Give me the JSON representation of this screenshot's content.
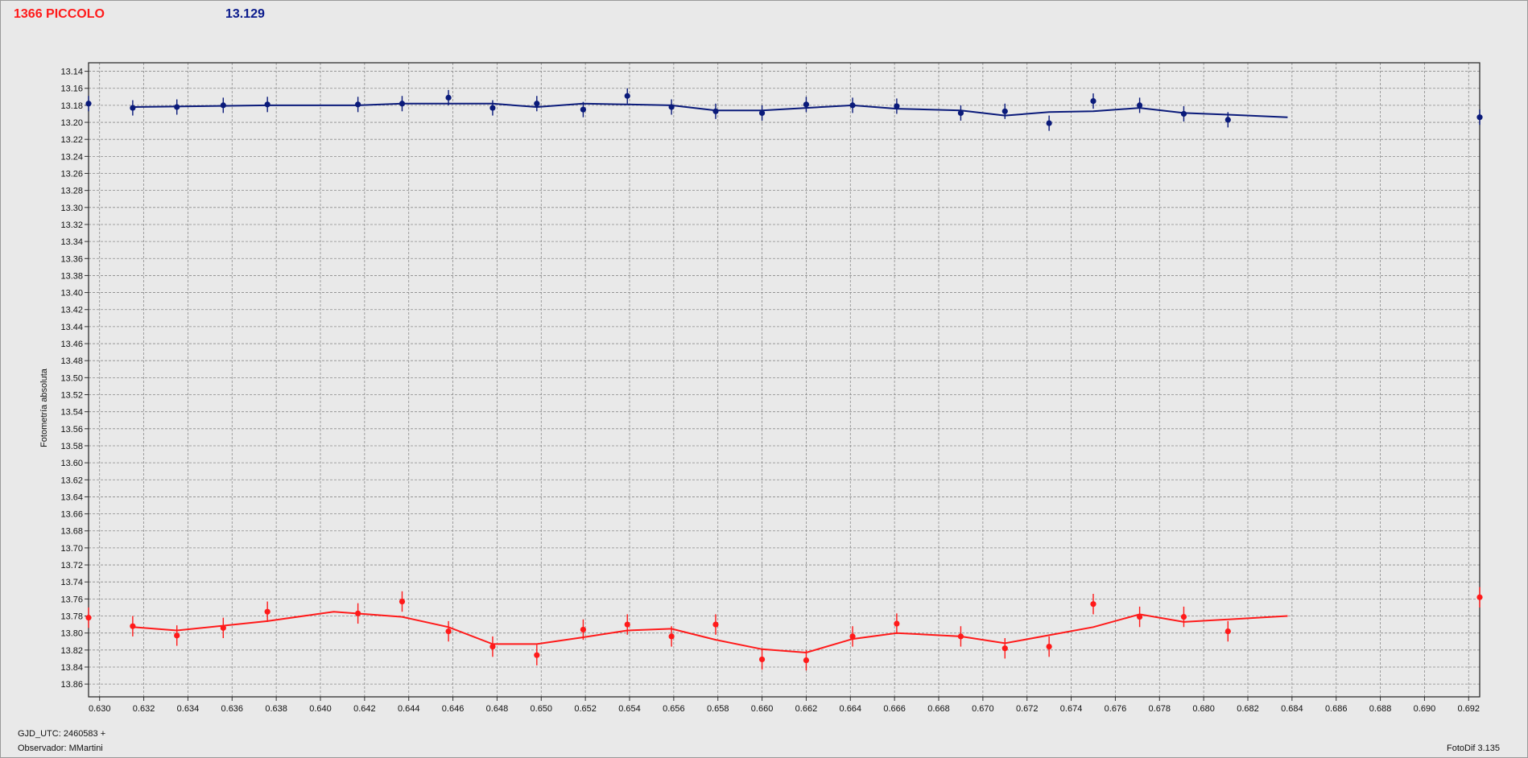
{
  "header": {
    "object_name": "1366 PICCOLO",
    "reference_mag": "13.129"
  },
  "footer": {
    "gjd_label": "GJD_UTC: 2460583 +",
    "observer_label": "Observador: MMartini",
    "software_label": "FotoDif 3.135"
  },
  "colors": {
    "series_blue": "#0a1a7a",
    "series_red": "#ff1a1a",
    "grid": "#8a8a8a",
    "plot_bg": "#e9e9e9"
  },
  "chart_data": {
    "type": "scatter",
    "title": "1366 PICCOLO",
    "xlabel": "GJD_UTC: 2460583 +",
    "ylabel": "Fotometría absoluta",
    "xlim": [
      0.6295,
      0.6925
    ],
    "ylim": [
      13.13,
      13.875
    ],
    "y_inverted": true,
    "grid": true,
    "x_ticks": [
      "0.630",
      "0.632",
      "0.634",
      "0.636",
      "0.638",
      "0.640",
      "0.642",
      "0.644",
      "0.646",
      "0.648",
      "0.650",
      "0.652",
      "0.654",
      "0.656",
      "0.658",
      "0.660",
      "0.662",
      "0.664",
      "0.666",
      "0.668",
      "0.670",
      "0.672",
      "0.674",
      "0.676",
      "0.678",
      "0.680",
      "0.682",
      "0.684",
      "0.686",
      "0.688",
      "0.690",
      "0.692"
    ],
    "y_ticks": [
      "13.14",
      "13.16",
      "13.18",
      "13.20",
      "13.22",
      "13.24",
      "13.26",
      "13.28",
      "13.30",
      "13.32",
      "13.34",
      "13.36",
      "13.38",
      "13.40",
      "13.42",
      "13.44",
      "13.46",
      "13.48",
      "13.50",
      "13.52",
      "13.54",
      "13.56",
      "13.58",
      "13.60",
      "13.62",
      "13.64",
      "13.66",
      "13.68",
      "13.70",
      "13.72",
      "13.74",
      "13.76",
      "13.78",
      "13.80",
      "13.82",
      "13.84",
      "13.86"
    ],
    "series": [
      {
        "color": "#0a1a7a",
        "points": [
          [
            0.6295,
            13.178
          ],
          [
            0.6315,
            13.183
          ],
          [
            0.6335,
            13.182
          ],
          [
            0.6356,
            13.18
          ],
          [
            0.6376,
            13.179
          ],
          [
            0.6417,
            13.179
          ],
          [
            0.6437,
            13.178
          ],
          [
            0.6458,
            13.171
          ],
          [
            0.6478,
            13.183
          ],
          [
            0.6498,
            13.178
          ],
          [
            0.6519,
            13.185
          ],
          [
            0.6539,
            13.169
          ],
          [
            0.6559,
            13.182
          ],
          [
            0.6579,
            13.187
          ],
          [
            0.66,
            13.189
          ],
          [
            0.662,
            13.179
          ],
          [
            0.6641,
            13.18
          ],
          [
            0.6661,
            13.181
          ],
          [
            0.669,
            13.189
          ],
          [
            0.671,
            13.187
          ],
          [
            0.673,
            13.201
          ],
          [
            0.675,
            13.175
          ],
          [
            0.6771,
            13.18
          ],
          [
            0.6791,
            13.19
          ],
          [
            0.6811,
            13.197
          ],
          [
            0.6925,
            13.194
          ]
        ],
        "error": 0.009,
        "trend": [
          [
            0.6315,
            13.182
          ],
          [
            0.6376,
            13.18
          ],
          [
            0.6417,
            13.18
          ],
          [
            0.6437,
            13.178
          ],
          [
            0.6478,
            13.178
          ],
          [
            0.6498,
            13.182
          ],
          [
            0.6519,
            13.178
          ],
          [
            0.6539,
            13.179
          ],
          [
            0.6559,
            13.18
          ],
          [
            0.6579,
            13.186
          ],
          [
            0.66,
            13.186
          ],
          [
            0.662,
            13.183
          ],
          [
            0.6641,
            13.18
          ],
          [
            0.6661,
            13.184
          ],
          [
            0.669,
            13.186
          ],
          [
            0.671,
            13.192
          ],
          [
            0.673,
            13.188
          ],
          [
            0.675,
            13.187
          ],
          [
            0.6771,
            13.183
          ],
          [
            0.6791,
            13.189
          ],
          [
            0.6811,
            13.191
          ],
          [
            0.6838,
            13.194
          ]
        ]
      },
      {
        "color": "#ff1a1a",
        "points": [
          [
            0.6295,
            13.782
          ],
          [
            0.6315,
            13.792
          ],
          [
            0.6335,
            13.803
          ],
          [
            0.6356,
            13.794
          ],
          [
            0.6376,
            13.775
          ],
          [
            0.6417,
            13.777
          ],
          [
            0.6437,
            13.763
          ],
          [
            0.6458,
            13.798
          ],
          [
            0.6478,
            13.816
          ],
          [
            0.6498,
            13.826
          ],
          [
            0.6519,
            13.796
          ],
          [
            0.6539,
            13.79
          ],
          [
            0.6559,
            13.804
          ],
          [
            0.6579,
            13.79
          ],
          [
            0.66,
            13.831
          ],
          [
            0.662,
            13.832
          ],
          [
            0.6641,
            13.804
          ],
          [
            0.6661,
            13.789
          ],
          [
            0.669,
            13.804
          ],
          [
            0.671,
            13.818
          ],
          [
            0.673,
            13.816
          ],
          [
            0.675,
            13.766
          ],
          [
            0.6771,
            13.781
          ],
          [
            0.6791,
            13.781
          ],
          [
            0.6811,
            13.798
          ],
          [
            0.6925,
            13.758
          ]
        ],
        "error": 0.012,
        "trend": [
          [
            0.6315,
            13.793
          ],
          [
            0.6335,
            13.797
          ],
          [
            0.6376,
            13.786
          ],
          [
            0.6406,
            13.775
          ],
          [
            0.6437,
            13.781
          ],
          [
            0.6458,
            13.793
          ],
          [
            0.6478,
            13.813
          ],
          [
            0.6498,
            13.813
          ],
          [
            0.6519,
            13.805
          ],
          [
            0.6539,
            13.797
          ],
          [
            0.6559,
            13.795
          ],
          [
            0.6579,
            13.808
          ],
          [
            0.66,
            13.819
          ],
          [
            0.662,
            13.823
          ],
          [
            0.6641,
            13.807
          ],
          [
            0.6661,
            13.8
          ],
          [
            0.669,
            13.804
          ],
          [
            0.671,
            13.812
          ],
          [
            0.675,
            13.793
          ],
          [
            0.6771,
            13.778
          ],
          [
            0.6791,
            13.787
          ],
          [
            0.6838,
            13.78
          ]
        ]
      }
    ]
  }
}
